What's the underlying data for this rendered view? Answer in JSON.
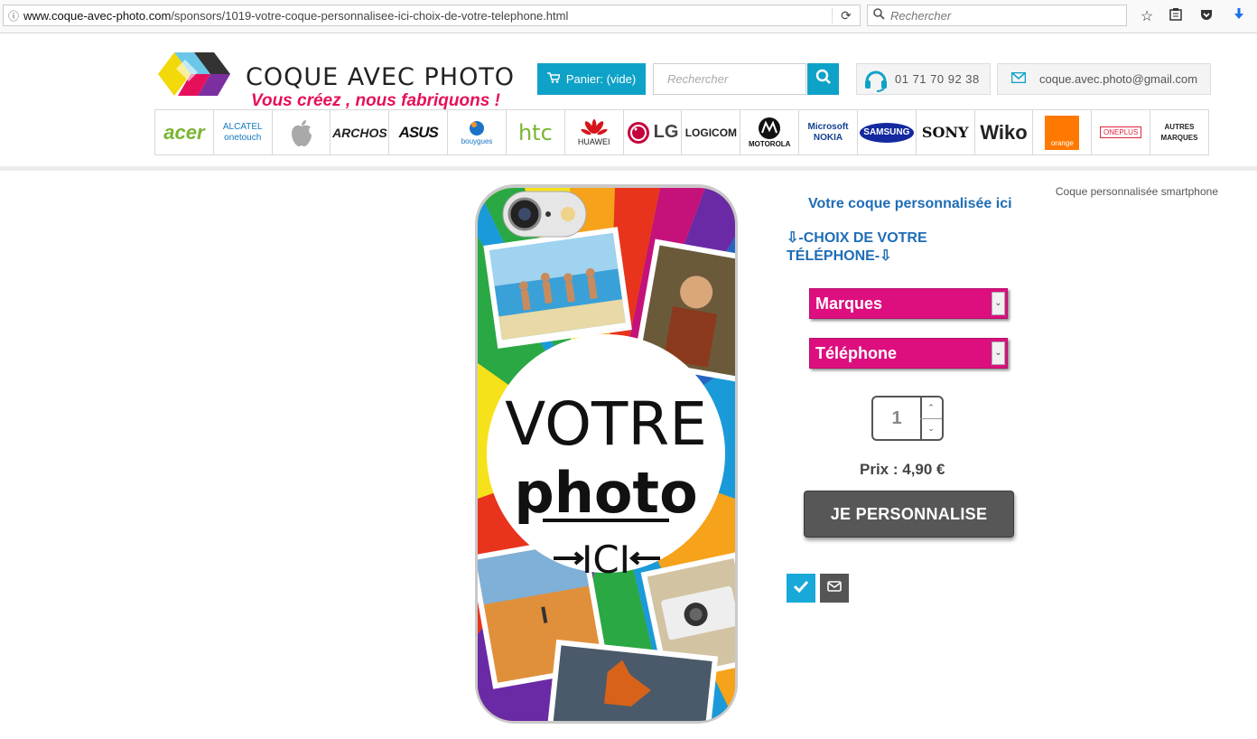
{
  "browser": {
    "url_host": "www.coque-avec-photo.com",
    "url_path": "/sponsors/1019-votre-coque-personnalisee-ici-choix-de-votre-telephone.html",
    "search_placeholder": "Rechercher"
  },
  "header": {
    "logo_title_1": "COQUE",
    "logo_title_2": " AVEC PHOTO",
    "tagline": "Vous créez , nous fabriquons !",
    "cart_label": "Panier: (vide)",
    "search_placeholder": "Rechercher",
    "phone": "01 71 70 92 38",
    "email": "coque.avec.photo@gmail.com",
    "accent_color": "#0fa2c8"
  },
  "brands": [
    {
      "name": "acer"
    },
    {
      "name": "ALCATEL onetouch"
    },
    {
      "name": "apple"
    },
    {
      "name": "ARCHOS"
    },
    {
      "name": "ASUS"
    },
    {
      "name": "bouygues"
    },
    {
      "name": "htc"
    },
    {
      "name": "HUAWEI"
    },
    {
      "name": "LG"
    },
    {
      "name": "LOGICOM"
    },
    {
      "name": "MOTOROLA"
    },
    {
      "name": "Microsoft NOKIA"
    },
    {
      "name": "SAMSUNG"
    },
    {
      "name": "SONY"
    },
    {
      "name": "Wiko"
    },
    {
      "name": "orange"
    },
    {
      "name": "ONEPLUS"
    },
    {
      "name": "AUTRES MARQUES"
    }
  ],
  "product": {
    "breadcrumb": "Coque personnalisée smartphone",
    "title": "Votre coque personnalisée ici",
    "choose": "⇩-CHOIX DE VOTRE TÉLÉPHONE-⇩",
    "select_brand": "Marques",
    "select_phone": "Téléphone",
    "quantity": "1",
    "price": "Prix : 4,90 €",
    "cta": "JE PERSONNALISE",
    "case_text_1": "VOTRE",
    "case_text_2": "photo",
    "case_text_3": "ICI",
    "select_color": "#dd0f7f"
  }
}
